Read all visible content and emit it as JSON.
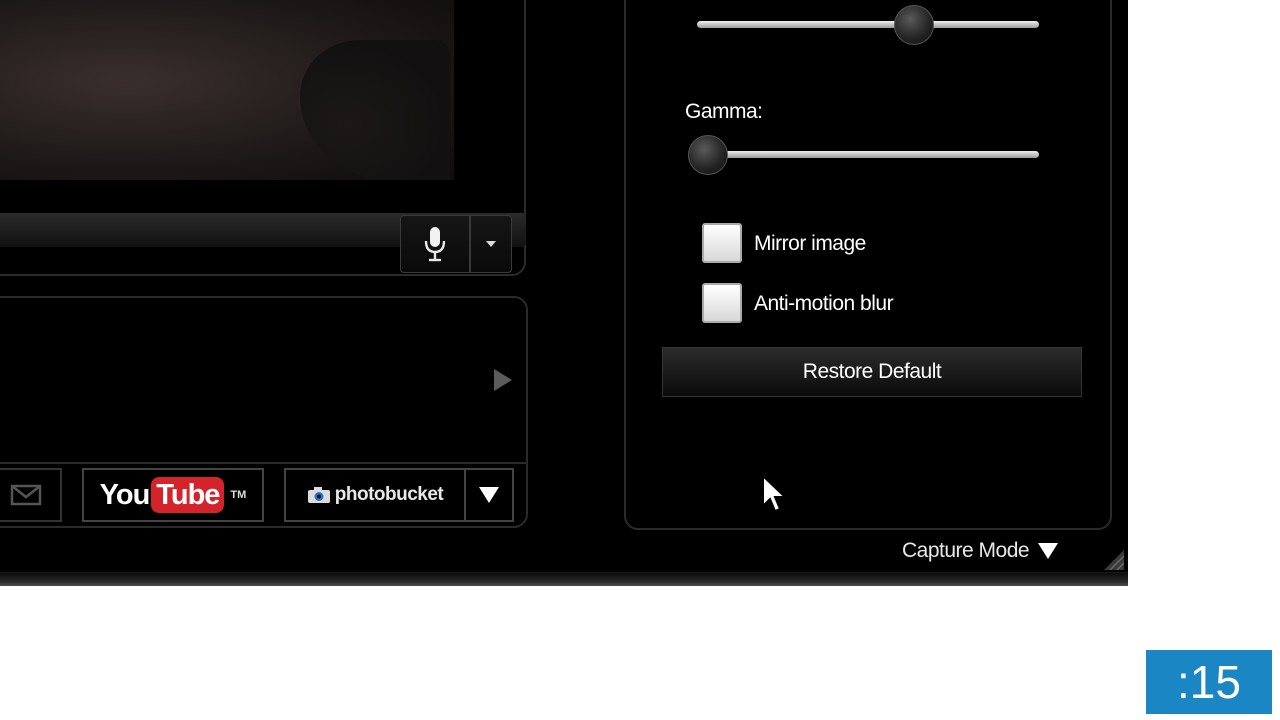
{
  "video": {
    "mic_icon": "microphone-icon",
    "dropdown_icon": "chevron-down-icon"
  },
  "share": {
    "next_icon": "play-arrow-icon",
    "email_icon": "envelope-icon",
    "youtube": {
      "you": "You",
      "tube": "Tube",
      "tm": "TM"
    },
    "photobucket": {
      "label": "photobucket",
      "icon": "camera-icon"
    },
    "more_icon": "triangle-down-icon"
  },
  "settings": {
    "top_slider": {
      "value": 0.64
    },
    "gamma": {
      "label": "Gamma:",
      "value": 0.0
    },
    "mirror_image": {
      "label": "Mirror image",
      "checked": false
    },
    "anti_motion_blur": {
      "label": "Anti-motion blur",
      "checked": false
    },
    "restore_default_label": "Restore Default"
  },
  "capture_mode": {
    "label": "Capture Mode",
    "icon": "triangle-down-icon"
  },
  "timer": {
    "text": ":15"
  },
  "colors": {
    "youtube_red": "#d4232b",
    "timer_blue": "#1a86c4",
    "background": "#000000"
  }
}
